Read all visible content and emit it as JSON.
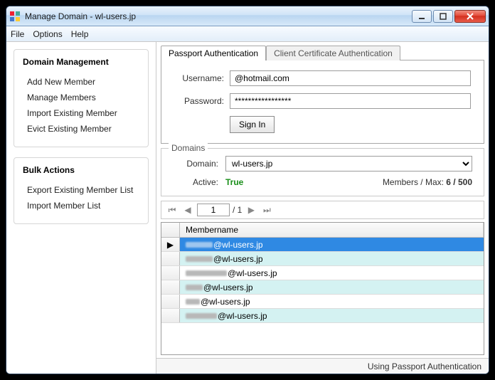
{
  "window": {
    "title": "Manage Domain - wl-users.jp"
  },
  "menubar": {
    "file": "File",
    "options": "Options",
    "help": "Help"
  },
  "sidebar": {
    "domain_mgmt": {
      "heading": "Domain Management",
      "items": [
        "Add New Member",
        "Manage Members",
        "Import Existing Member",
        "Evict Existing Member"
      ]
    },
    "bulk": {
      "heading": "Bulk Actions",
      "items": [
        "Export Existing Member List",
        "Import Member List"
      ]
    }
  },
  "tabs": {
    "passport": "Passport Authentication",
    "clientcert": "Client Certificate Authentication"
  },
  "auth": {
    "username_label": "Username:",
    "username_value": "@hotmail.com",
    "password_label": "Password:",
    "password_value": "*****************",
    "signin": "Sign In"
  },
  "domains": {
    "legend": "Domains",
    "domain_label": "Domain:",
    "domain_value": "wl-users.jp",
    "active_label": "Active:",
    "active_value": "True",
    "members_label": "Members / Max:",
    "members_value": "6 / 500"
  },
  "pager": {
    "page": "1",
    "total": "/ 1"
  },
  "grid": {
    "header": "Membername",
    "rows": [
      "@wl-users.jp",
      "@wl-users.jp",
      "@wl-users.jp",
      "@wl-users.jp",
      "@wl-users.jp",
      "@wl-users.jp"
    ]
  },
  "status": "Using Passport Authentication"
}
